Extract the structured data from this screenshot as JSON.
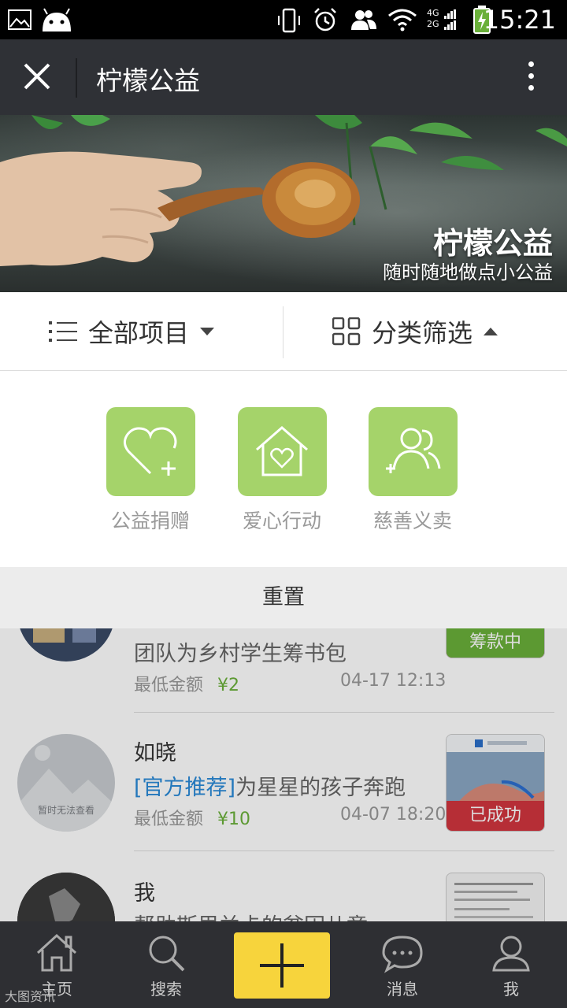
{
  "status_bar": {
    "time": "15:21",
    "network_top": "4G",
    "network_bottom": "2G"
  },
  "title_bar": {
    "title": "柠檬公益"
  },
  "banner": {
    "title": "柠檬公益",
    "subtitle": "随时随地做点小公益"
  },
  "filters": {
    "all_projects": "全部项目",
    "category_filter": "分类筛选"
  },
  "categories": [
    {
      "label": "公益捐赠",
      "icon": "heart-plus-icon"
    },
    {
      "label": "爱心行动",
      "icon": "house-heart-icon"
    },
    {
      "label": "慈善义卖",
      "icon": "people-plus-icon"
    }
  ],
  "reset_label": "重置",
  "colors": {
    "accent_green": "#a5d36a",
    "amount_green": "#6ab03a",
    "tag_blue": "#2a8ad8",
    "add_button": "#f7d43c",
    "title_bar": "#2f3136"
  },
  "list": [
    {
      "desc": "团队为乡村学生筹书包",
      "min_label": "最低金额",
      "amount": "¥2",
      "time": "04-17 12:13",
      "status": "筹款中"
    },
    {
      "name": "如晓",
      "tag": "[官方推荐]",
      "desc": "为星星的孩子奔跑",
      "min_label": "最低金额",
      "amount": "¥10",
      "time": "04-07 18:20",
      "status": "已成功",
      "avatar_text": "暂时无法查看"
    },
    {
      "name": "我",
      "desc": "帮助斯里兰卡的贫困儿童"
    }
  ],
  "bottom_nav": {
    "home": "主页",
    "search": "搜索",
    "messages": "消息",
    "me": "我"
  },
  "watermark": "大图资讯"
}
